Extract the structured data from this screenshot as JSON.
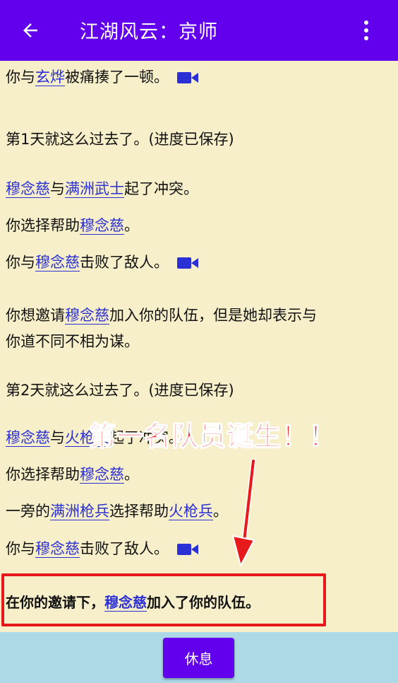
{
  "app_bar": {
    "title": "江湖风云：京师",
    "back_icon": "arrow-left-icon",
    "more_icon": "more-vertical-icon",
    "color": "#6200ee"
  },
  "log": [
    {
      "parts": [
        {
          "t": "你与"
        },
        {
          "t": "玄烨",
          "link": true
        },
        {
          "t": "被痛揍了一顿。"
        }
      ],
      "replay": true
    },
    {
      "parts": [
        {
          "t": "第1天就这么过去了。(进度已保存)"
        }
      ]
    },
    {
      "parts": [
        {
          "t": "穆念慈",
          "link": true
        },
        {
          "t": "与"
        },
        {
          "t": "满洲武士",
          "link": true
        },
        {
          "t": "起了冲突。"
        }
      ]
    },
    {
      "parts": [
        {
          "t": "你选择帮助"
        },
        {
          "t": "穆念慈",
          "link": true
        },
        {
          "t": "。"
        }
      ]
    },
    {
      "parts": [
        {
          "t": "你与"
        },
        {
          "t": "穆念慈",
          "link": true
        },
        {
          "t": "击败了敌人。"
        }
      ],
      "replay": true
    },
    {
      "parts": [
        {
          "t": "你想邀请"
        },
        {
          "t": "穆念慈",
          "link": true
        },
        {
          "t": "加入你的队伍，但是她却表示与"
        }
      ]
    },
    {
      "parts": [
        {
          "t": "你道不同不相为谋。"
        }
      ]
    },
    {
      "parts": [
        {
          "t": "第2天就这么过去了。(进度已保存)"
        }
      ]
    },
    {
      "parts": [
        {
          "t": "穆念慈",
          "link": true
        },
        {
          "t": "与"
        },
        {
          "t": "火枪兵",
          "link": true
        },
        {
          "t": "起了冲突。"
        }
      ]
    },
    {
      "parts": [
        {
          "t": "你选择帮助"
        },
        {
          "t": "穆念慈",
          "link": true
        },
        {
          "t": "。"
        }
      ]
    },
    {
      "parts": [
        {
          "t": "一旁的"
        },
        {
          "t": "满洲枪兵",
          "link": true
        },
        {
          "t": "选择帮助"
        },
        {
          "t": "火枪兵",
          "link": true
        },
        {
          "t": "。"
        }
      ]
    },
    {
      "parts": [
        {
          "t": "你与"
        },
        {
          "t": "穆念慈",
          "link": true
        },
        {
          "t": "击败了敌人。"
        }
      ],
      "replay": true
    },
    {
      "parts": [
        {
          "t": "在你的邀请下，"
        },
        {
          "t": "穆念慈",
          "link": true
        },
        {
          "t": "加入了你的队伍。"
        }
      ],
      "bold": true
    }
  ],
  "replay_icon": "video-camera-icon",
  "annotation": {
    "text": "第一名队员诞生！！",
    "color": "#ff2a2a"
  },
  "highlight_color": "#e8191b",
  "bottom": {
    "rest_label": "休息",
    "bar_color": "#add8e6"
  }
}
